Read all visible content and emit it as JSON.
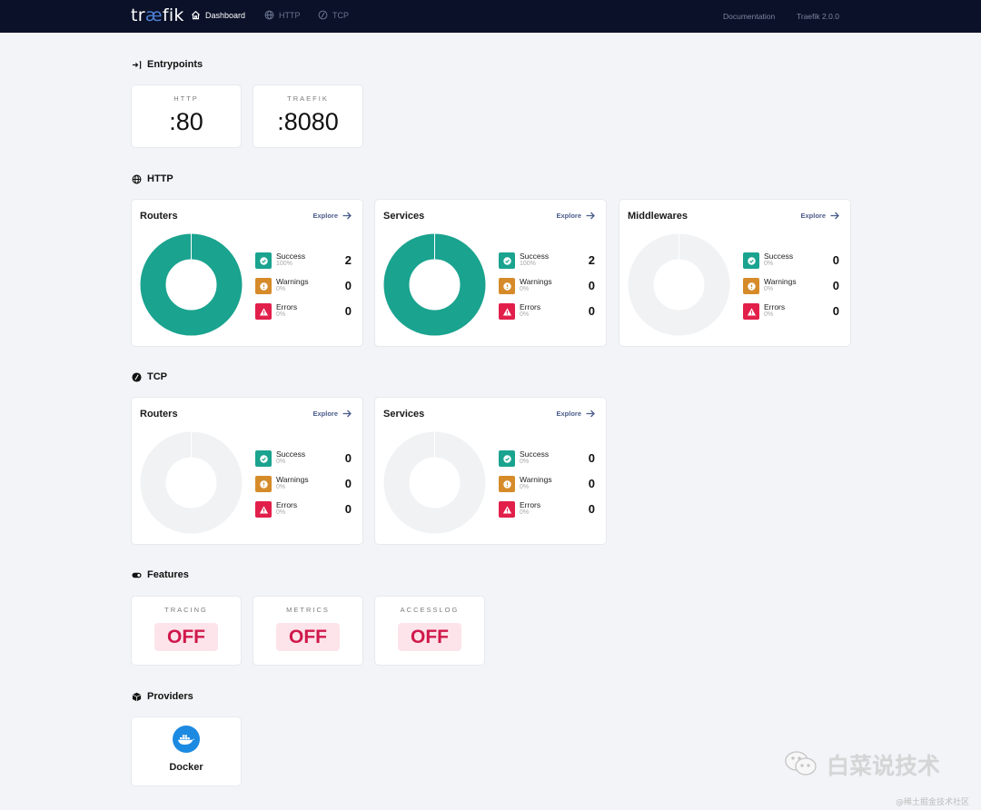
{
  "nav": {
    "logo_prefix": "tr",
    "logo_ae": "æ",
    "logo_suffix": "fik",
    "items": [
      {
        "label": "Dashboard",
        "icon": "home-icon",
        "active": true
      },
      {
        "label": "HTTP",
        "icon": "globe-icon",
        "active": false
      },
      {
        "label": "TCP",
        "icon": "tcp-icon",
        "active": false
      }
    ],
    "documentation": "Documentation",
    "version": "Traefik 2.0.0"
  },
  "entrypoints": {
    "title": "Entrypoints",
    "items": [
      {
        "name": "HTTP",
        "port": ":80"
      },
      {
        "name": "TRAEFIK",
        "port": ":8080"
      }
    ]
  },
  "http": {
    "title": "HTTP",
    "cards": [
      {
        "title": "Routers",
        "explore": "Explore",
        "stats": [
          {
            "label": "Success",
            "percent": "100%",
            "count": "2",
            "value": 2
          },
          {
            "label": "Warnings",
            "percent": "0%",
            "count": "0",
            "value": 0
          },
          {
            "label": "Errors",
            "percent": "0%",
            "count": "0",
            "value": 0
          }
        ]
      },
      {
        "title": "Services",
        "explore": "Explore",
        "stats": [
          {
            "label": "Success",
            "percent": "100%",
            "count": "2",
            "value": 2
          },
          {
            "label": "Warnings",
            "percent": "0%",
            "count": "0",
            "value": 0
          },
          {
            "label": "Errors",
            "percent": "0%",
            "count": "0",
            "value": 0
          }
        ]
      },
      {
        "title": "Middlewares",
        "explore": "Explore",
        "stats": [
          {
            "label": "Success",
            "percent": "0%",
            "count": "0",
            "value": 0
          },
          {
            "label": "Warnings",
            "percent": "0%",
            "count": "0",
            "value": 0
          },
          {
            "label": "Errors",
            "percent": "0%",
            "count": "0",
            "value": 0
          }
        ]
      }
    ]
  },
  "tcp": {
    "title": "TCP",
    "cards": [
      {
        "title": "Routers",
        "explore": "Explore",
        "stats": [
          {
            "label": "Success",
            "percent": "0%",
            "count": "0",
            "value": 0
          },
          {
            "label": "Warnings",
            "percent": "0%",
            "count": "0",
            "value": 0
          },
          {
            "label": "Errors",
            "percent": "0%",
            "count": "0",
            "value": 0
          }
        ]
      },
      {
        "title": "Services",
        "explore": "Explore",
        "stats": [
          {
            "label": "Success",
            "percent": "0%",
            "count": "0",
            "value": 0
          },
          {
            "label": "Warnings",
            "percent": "0%",
            "count": "0",
            "value": 0
          },
          {
            "label": "Errors",
            "percent": "0%",
            "count": "0",
            "value": 0
          }
        ]
      }
    ]
  },
  "features": {
    "title": "Features",
    "items": [
      {
        "name": "TRACING",
        "value": "OFF"
      },
      {
        "name": "METRICS",
        "value": "OFF"
      },
      {
        "name": "ACCESSLOG",
        "value": "OFF"
      }
    ]
  },
  "providers": {
    "title": "Providers",
    "items": [
      {
        "name": "Docker",
        "icon": "docker-icon"
      }
    ]
  },
  "colors": {
    "navbar": "#0a1128",
    "success": "#1aa38f",
    "warning": "#d68b2a",
    "error": "#e21f4b",
    "donut_empty": "#f0f2f4",
    "off_text": "#d0184b",
    "off_bg": "#fce4ea",
    "docker": "#1d8ae2"
  },
  "watermark": {
    "text": "白菜说技术",
    "subtext": "@稀土掘金技术社区"
  }
}
